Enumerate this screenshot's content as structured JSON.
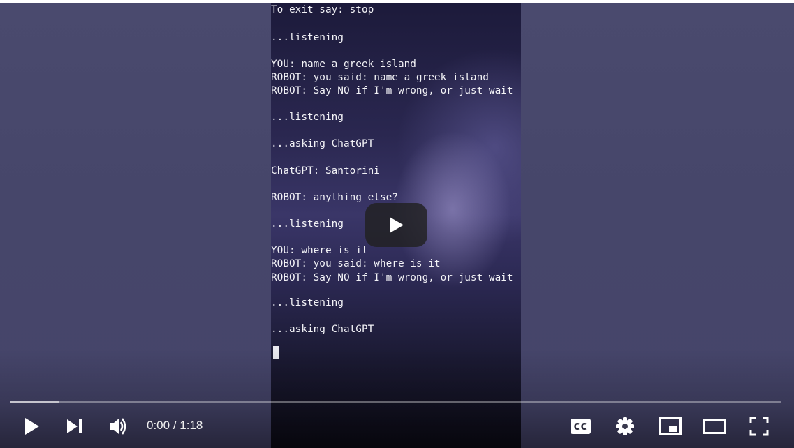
{
  "player": {
    "terminal_lines": [
      "To exit say: stop",
      "...listening",
      "YOU: name a greek island",
      "ROBOT: you said: name a greek island",
      "ROBOT: Say NO if I'm wrong, or just wait",
      "...listening",
      "...asking ChatGPT",
      "ChatGPT: Santorini",
      "ROBOT: anything else?",
      "...listening",
      "YOU: where is it",
      "ROBOT: you said: where is it",
      "ROBOT: Say NO if I'm wrong, or just wait",
      "...listening",
      "...asking ChatGPT"
    ],
    "progress": {
      "played_fraction": 0.0,
      "loaded_fraction": 0.063
    },
    "time": {
      "current": "0:00",
      "separator": " / ",
      "duration": "1:18"
    },
    "controls": {
      "play_icon": "play-icon",
      "next_icon": "skip-next-icon",
      "volume_icon": "volume-icon",
      "captions_icon": "closed-captions-icon",
      "settings_icon": "gear-icon",
      "miniplayer_icon": "miniplayer-icon",
      "theater_icon": "theater-mode-icon",
      "fullscreen_icon": "fullscreen-icon"
    },
    "colors": {
      "progress_played": "#ff0000",
      "big_play_bg": "#212121",
      "icon": "#ffffff"
    }
  }
}
